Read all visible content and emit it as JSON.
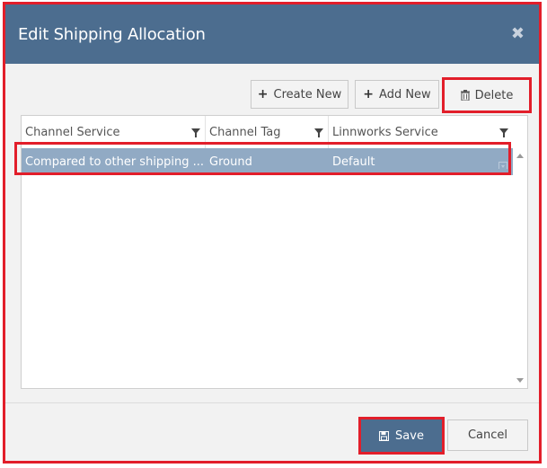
{
  "dialog": {
    "title": "Edit Shipping Allocation",
    "close_glyph": "✖"
  },
  "toolbar": {
    "create_new_label": "Create New",
    "add_new_label": "Add New",
    "delete_label": "Delete"
  },
  "grid": {
    "columns": [
      "Channel Service",
      "Channel Tag",
      "Linnworks Service"
    ],
    "rows": [
      {
        "channel_service": "Compared to other shipping ...",
        "channel_tag": "Ground",
        "linnworks_service": "Default"
      }
    ]
  },
  "footer": {
    "save_label": "Save",
    "cancel_label": "Cancel"
  },
  "icons": {
    "plus": "plus-icon",
    "trash": "trash-icon",
    "filter": "filter-icon",
    "save": "floppy-disk-icon"
  },
  "colors": {
    "header": "#4c6d8f",
    "selected_row": "#91aac4",
    "highlight": "#e21e2a"
  }
}
